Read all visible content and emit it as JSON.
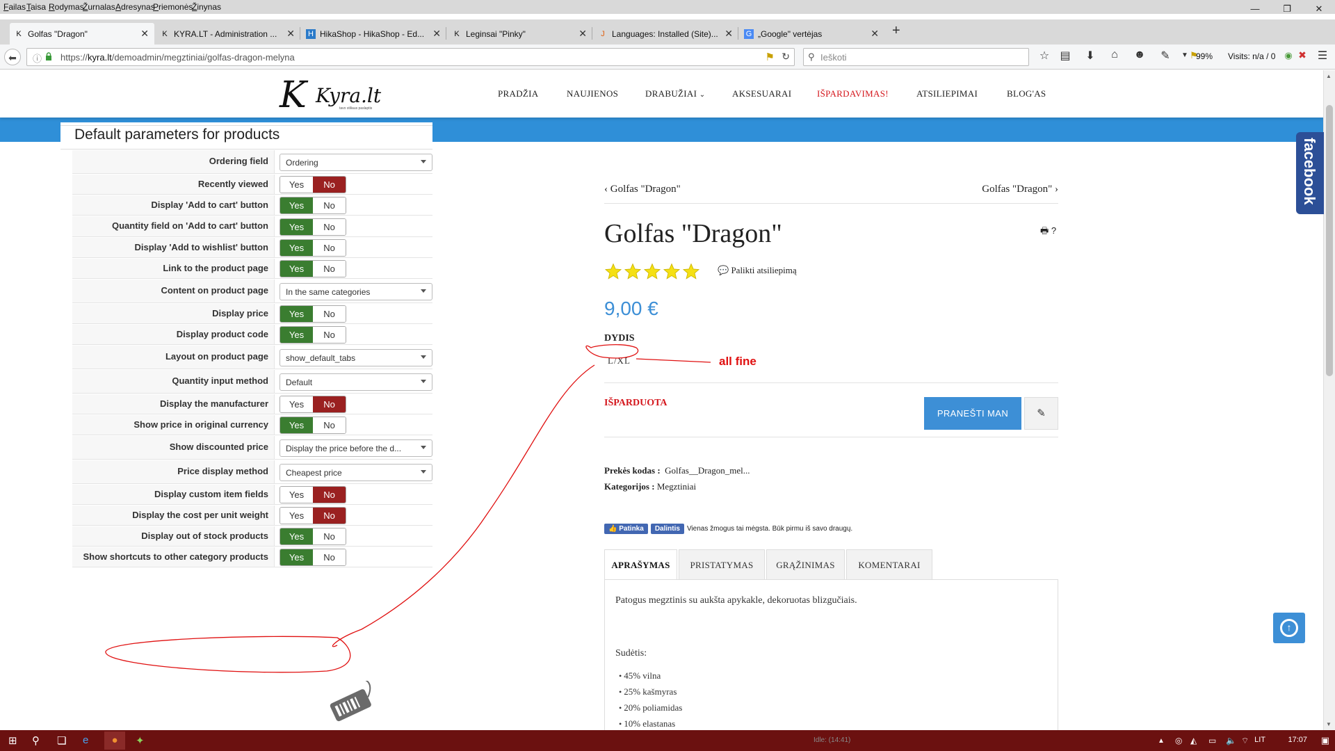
{
  "browser": {
    "menu": [
      "Failas",
      "Taisa",
      "Rodymas",
      "Žurnalas",
      "Adresynas",
      "Priemonės",
      "Žinynas"
    ],
    "tabs": [
      {
        "title": "Golfas \"Dragon\"",
        "icon": "K",
        "active": true
      },
      {
        "title": "KYRA.LT - Administration ...",
        "icon": "K",
        "active": false
      },
      {
        "title": "HikaShop - HikaShop - Ed...",
        "icon": "H",
        "active": false
      },
      {
        "title": "Leginsai \"Pinky\"",
        "icon": "K",
        "active": false
      },
      {
        "title": "Languages: Installed (Site)...",
        "icon": "J",
        "active": false
      },
      {
        "title": "„Google\" vertėjas",
        "icon": "G",
        "active": false
      }
    ],
    "url_prefix": "https://",
    "url_host": "kyra.lt",
    "url_path": "/demoadmin/megztiniai/golfas-dragon-melyna",
    "search_placeholder": "Ieškoti",
    "zoom": "99%",
    "visits": "Visits: n/a / 0",
    "new_tab": "+",
    "window_controls": {
      "minimize": "—",
      "maximize": "❐",
      "close": "✕"
    }
  },
  "site": {
    "logo_letter": "K",
    "logo_text": "Kyra.lt",
    "logo_tagline": "tavo stiliaus paslaptis",
    "nav": [
      {
        "label": "PRADŽIA",
        "red": false
      },
      {
        "label": "NAUJIENOS",
        "red": false
      },
      {
        "label": "DRABUŽIAI",
        "red": false,
        "dropdown": true
      },
      {
        "label": "AKSESUARAI",
        "red": false
      },
      {
        "label": "IŠPARDAVIMAS!",
        "red": true
      },
      {
        "label": "ATSILIEPIMAI",
        "red": false
      },
      {
        "label": "BLOG'AS",
        "red": false
      }
    ]
  },
  "admin": {
    "title": "Default parameters for products",
    "rows": [
      {
        "label": "Ordering field",
        "type": "select",
        "value": "Ordering"
      },
      {
        "label": "Recently viewed",
        "type": "yesno",
        "value": "No"
      },
      {
        "label": "Display 'Add to cart' button",
        "type": "yesno",
        "value": "Yes"
      },
      {
        "label": "Quantity field on 'Add to cart' button",
        "type": "yesno",
        "value": "Yes"
      },
      {
        "label": "Display 'Add to wishlist' button",
        "type": "yesno",
        "value": "Yes"
      },
      {
        "label": "Link to the product page",
        "type": "yesno",
        "value": "Yes"
      },
      {
        "label": "Content on product page",
        "type": "select",
        "value": "In the same categories"
      },
      {
        "label": "Display price",
        "type": "yesno",
        "value": "Yes"
      },
      {
        "label": "Display product code",
        "type": "yesno",
        "value": "Yes"
      },
      {
        "label": "Layout on product page",
        "type": "select",
        "value": "show_default_tabs"
      },
      {
        "label": "Quantity input method",
        "type": "select",
        "value": "Default"
      },
      {
        "label": "Display the manufacturer",
        "type": "yesno",
        "value": "No"
      },
      {
        "label": "Show price in original currency",
        "type": "yesno",
        "value": "Yes"
      },
      {
        "label": "Show discounted price",
        "type": "select",
        "value": "Display the price before the d..."
      },
      {
        "label": "Price display method",
        "type": "select",
        "value": "Cheapest price"
      },
      {
        "label": "Display custom item fields",
        "type": "yesno",
        "value": "No"
      },
      {
        "label": "Display the cost per unit weight",
        "type": "yesno",
        "value": "No"
      },
      {
        "label": "Display out of stock products",
        "type": "yesno",
        "value": "Yes"
      },
      {
        "label": "Show shortcuts to other category products",
        "type": "yesno",
        "value": "Yes"
      }
    ],
    "yes_label": "Yes",
    "no_label": "No"
  },
  "product": {
    "prev": "Golfas \"Dragon\"",
    "next": "Golfas \"Dragon\"",
    "title": "Golfas \"Dragon\"",
    "rating_stars": 5,
    "review_link": "Palikti atsiliepimą",
    "price": "9,00 €",
    "size_label": "DYDIS",
    "size_value": "L/XL",
    "soldout": "IŠPARDUOTA",
    "notify_button": "PRANEŠTI MAN",
    "code_label": "Prekės kodas :",
    "code_value": "Golfas__Dragon_mel...",
    "category_label": "Kategorijos :",
    "category_value": "Megztiniai",
    "fb_like": "Patinka",
    "fb_share": "Dalintis",
    "fb_text": "Vienas žmogus tai mėgsta. Būk pirmu iš savo draugų.",
    "tabs": [
      "APRAŠYMAS",
      "PRISTATYMAS",
      "GRĄŽINIMAS",
      "KOMENTARAI"
    ],
    "description": "Patogus megztinis su aukšta apykakle, dekoruotas blizgučiais.",
    "composition_title": "Sudėtis:",
    "composition": [
      "45% vilna",
      "25% kašmyras",
      "20% poliamidas",
      "10% elastanas"
    ]
  },
  "annotation": {
    "text": "all fine",
    "color": "#e01010"
  },
  "facebook_tab": "facebook",
  "taskbar": {
    "language": "LIT",
    "time": "17:07",
    "idle": "Idle: (14:41)"
  },
  "colors": {
    "accent_blue": "#3d8fd6",
    "banner_blue": "#2f8fd8",
    "sale_red": "#d4161c",
    "yes_green": "#3a7d30",
    "no_red": "#9a2020",
    "taskbar": "#6b1110"
  }
}
